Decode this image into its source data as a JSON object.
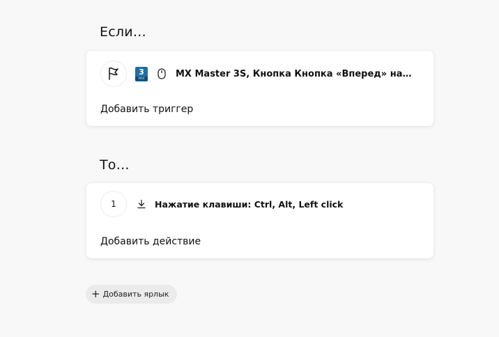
{
  "if_section": {
    "title": "Если…",
    "trigger_text": "MX Master 3S, Кнопка Кнопка «Вперед» на…",
    "app_icon_number": "3",
    "app_icon_sub": "MAX",
    "add_trigger_label": "Добавить триггер"
  },
  "then_section": {
    "title": "То…",
    "step_number": "1",
    "action_text": "Нажатие клавиши: Ctrl, Alt, Left click",
    "add_action_label": "Добавить действие"
  },
  "add_shortcut_label": "Добавить ярлык",
  "colors": {
    "background": "#f8f8f8",
    "card": "#ffffff",
    "app_icon": "#1e6fa8",
    "pill": "#ebebeb"
  },
  "icons": [
    "flag-icon",
    "3dsmax-app-icon",
    "mouse-icon",
    "download-icon",
    "plus-icon"
  ]
}
